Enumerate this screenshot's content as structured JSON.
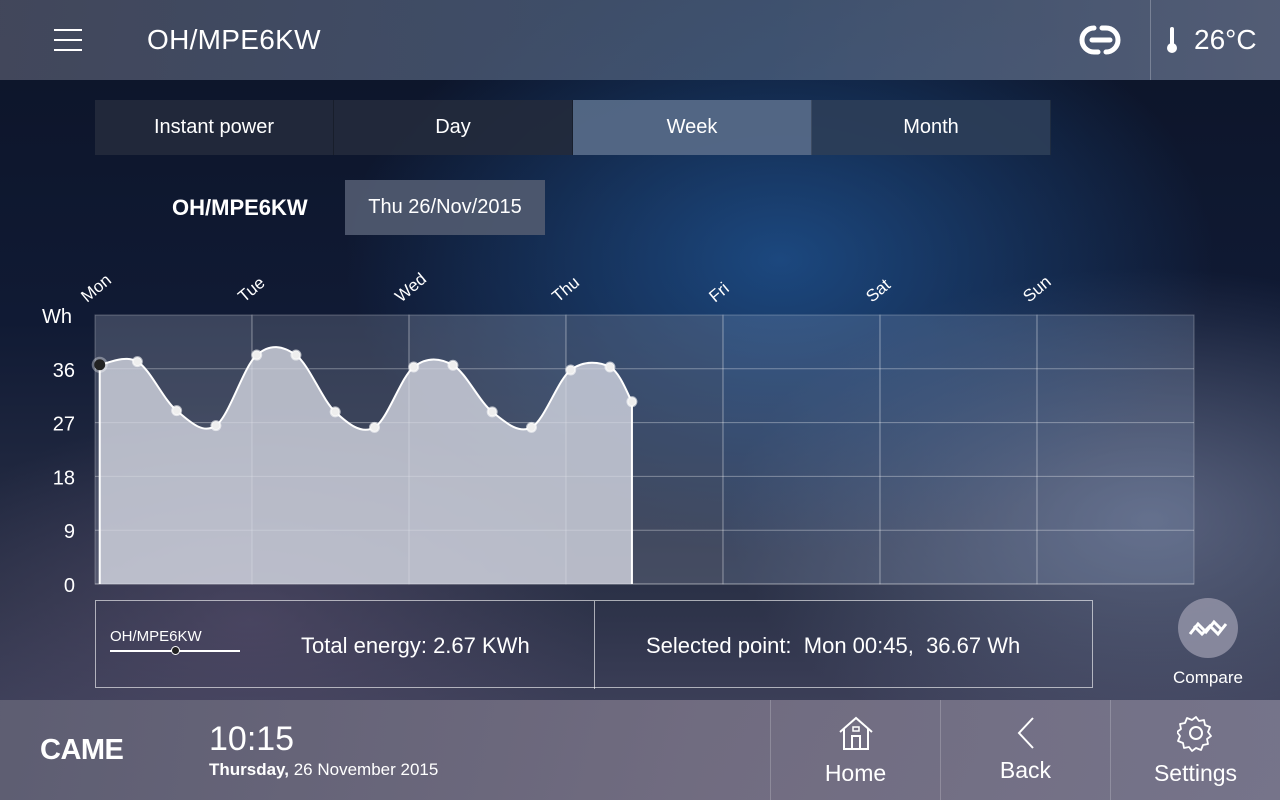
{
  "header": {
    "title": "OH/MPE6KW",
    "temperature": "26°C"
  },
  "tabs": [
    {
      "label": "Instant power",
      "active": false
    },
    {
      "label": "Day",
      "active": false
    },
    {
      "label": "Week",
      "active": true
    },
    {
      "label": "Month",
      "active": false
    }
  ],
  "device_label": "OH/MPE6KW",
  "selected_date": "Thu 26/Nov/2015",
  "chart_data": {
    "type": "area",
    "ylabel": "Wh",
    "yticks": [
      0,
      9,
      18,
      27,
      36
    ],
    "ylim": [
      0,
      45
    ],
    "days": [
      "Mon",
      "Tue",
      "Wed",
      "Thu",
      "Fri",
      "Sat",
      "Sun"
    ],
    "x_units": "days from start of week",
    "points": [
      [
        0.03,
        36.67
      ],
      [
        0.27,
        37.2
      ],
      [
        0.52,
        29
      ],
      [
        0.77,
        26.5
      ],
      [
        1.03,
        38.3
      ],
      [
        1.28,
        38.3
      ],
      [
        1.53,
        28.8
      ],
      [
        1.78,
        26.2
      ],
      [
        2.03,
        36.3
      ],
      [
        2.28,
        36.6
      ],
      [
        2.53,
        28.8
      ],
      [
        2.78,
        26.2
      ],
      [
        3.03,
        35.8
      ],
      [
        3.28,
        36.3
      ],
      [
        3.42,
        30.5
      ]
    ],
    "selected_index": 0,
    "grid": true
  },
  "legend": {
    "series_name": "OH/MPE6KW",
    "total_energy": "Total energy: 2.67 KWh",
    "selected_point": "Selected point:  Mon 00:45,  36.67 Wh"
  },
  "compare": {
    "label": "Compare"
  },
  "footer": {
    "logo": "CAME",
    "time": "10:15",
    "weekday": "Thursday,",
    "date": "26 November 2015",
    "nav": [
      {
        "label": "Home",
        "icon": "home-icon"
      },
      {
        "label": "Back",
        "icon": "back-icon"
      },
      {
        "label": "Settings",
        "icon": "gear-icon"
      }
    ]
  }
}
